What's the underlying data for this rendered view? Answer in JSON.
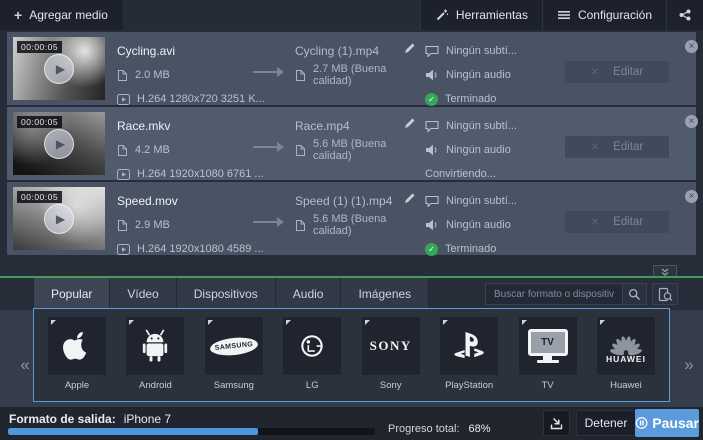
{
  "toolbar": {
    "add_media": "Agregar medio",
    "tools": "Herramientas",
    "settings": "Configuración"
  },
  "labels": {
    "edit": "Editar"
  },
  "rows": [
    {
      "duration": "00:00:05",
      "name": "Cycling.avi",
      "size": "2.0 MB",
      "codec": "H.264 1280x720 3251 K...",
      "out_name": "Cycling (1).mp4",
      "out_size": "2.7 MB (Buena calidad)",
      "subtitles": "Ningún subtí...",
      "audio": "Ningún audio",
      "status": "Terminado"
    },
    {
      "duration": "00:00:05",
      "name": "Race.mkv",
      "size": "4.2 MB",
      "codec": "H.264 1920x1080 6761 ...",
      "out_name": "Race.mp4",
      "out_size": "5.6 MB (Buena calidad)",
      "subtitles": "Ningún subtí...",
      "audio": "Ningún audio",
      "status": "Convirtiendo..."
    },
    {
      "duration": "00:00:05",
      "name": "Speed.mov",
      "size": "2.9 MB",
      "codec": "H.264 1920x1080 4589 ...",
      "out_name": "Speed (1) (1).mp4",
      "out_size": "5.6 MB (Buena calidad)",
      "subtitles": "Ningún subtí...",
      "audio": "Ningún audio",
      "status": "Terminado"
    }
  ],
  "tabs": [
    {
      "label": "Popular"
    },
    {
      "label": "Vídeo"
    },
    {
      "label": "Dispositivos"
    },
    {
      "label": "Audio"
    },
    {
      "label": "Imágenes"
    }
  ],
  "search": {
    "placeholder": "Buscar formato o dispositivo..."
  },
  "devices": [
    {
      "label": "Apple"
    },
    {
      "label": "Android"
    },
    {
      "label": "Samsung",
      "logo_text": "SAMSUNG"
    },
    {
      "label": "LG"
    },
    {
      "label": "Sony",
      "logo_text": "SONY"
    },
    {
      "label": "PlayStation"
    },
    {
      "label": "TV",
      "logo_text": "TV"
    },
    {
      "label": "Huawei",
      "logo_text": "HUAWEI"
    }
  ],
  "footer": {
    "output_label": "Formato de salida:",
    "output_value": "iPhone 7",
    "progress_label": "Progreso total:",
    "progress_value": "68%",
    "progress_pct": 68,
    "stop": "Detener",
    "pause": "Pausar"
  },
  "colors": {
    "accent_blue": "#5b9bdc",
    "progress_blue": "#4e96e0",
    "green_line": "#3f9e58",
    "status_green": "#35a759"
  }
}
